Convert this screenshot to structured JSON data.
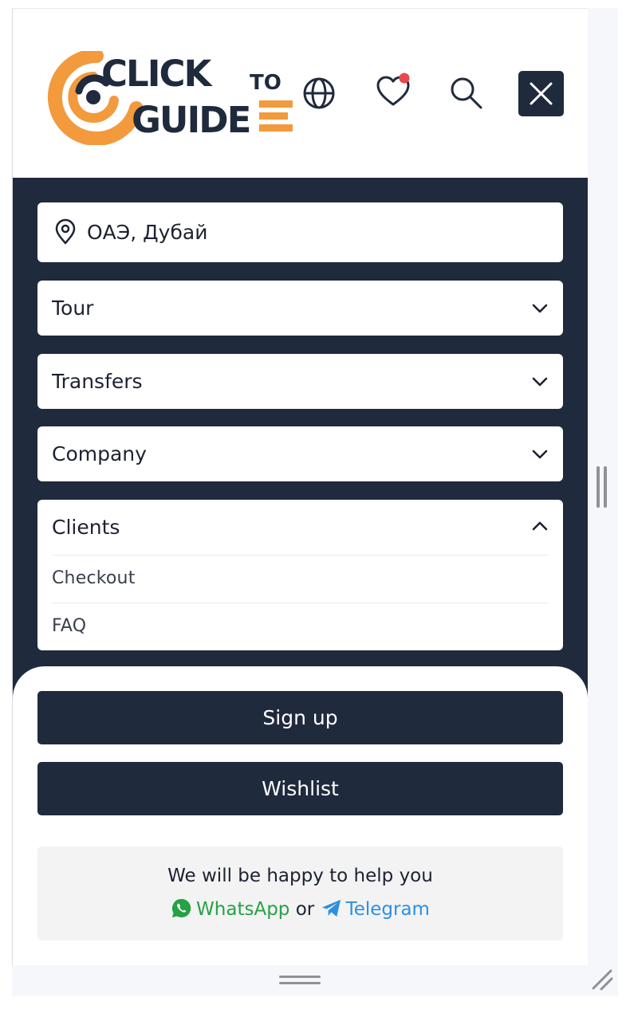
{
  "header": {
    "logo_text_line1": "CLICK",
    "logo_text_to": "TO",
    "logo_text_line2": "GUIDE"
  },
  "location": {
    "value": "ОАЭ, Дубай"
  },
  "menu": {
    "items": [
      {
        "label": "Tour",
        "expanded": false
      },
      {
        "label": "Transfers",
        "expanded": false
      },
      {
        "label": "Company",
        "expanded": false
      },
      {
        "label": "Clients",
        "expanded": true,
        "children": [
          "Checkout",
          "FAQ"
        ]
      }
    ]
  },
  "actions": {
    "signup_label": "Sign up",
    "wishlist_label": "Wishlist"
  },
  "help": {
    "line1": "We will be happy to help you",
    "whatsapp": "WhatsApp",
    "or": "or",
    "telegram": "Telegram"
  },
  "colors": {
    "navy": "#1f2a3d",
    "orange": "#f29a3c",
    "notification_dot": "#e5484d",
    "whatsapp": "#25a244",
    "telegram": "#2d8fe0"
  },
  "icons": [
    "globe-icon",
    "heart-icon",
    "search-icon",
    "close-icon",
    "location-pin-icon",
    "chevron-down-icon",
    "chevron-up-icon",
    "whatsapp-icon",
    "telegram-icon"
  ]
}
